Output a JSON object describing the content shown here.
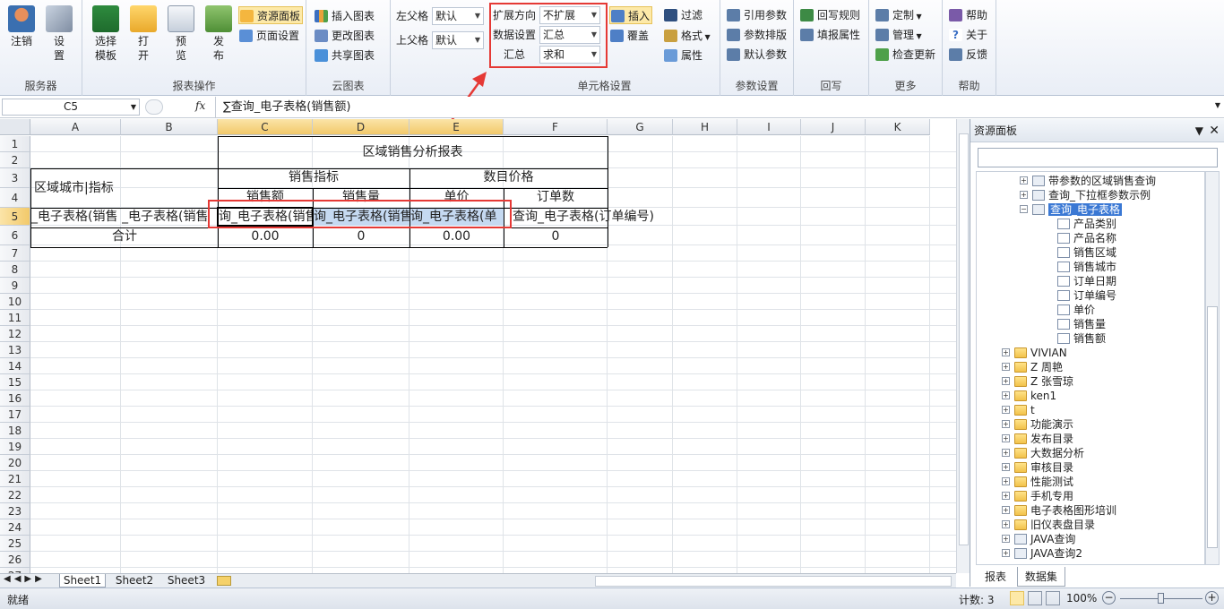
{
  "ribbon": {
    "groups": {
      "server": {
        "label": "服务器",
        "logout": "注销",
        "settings": "设置"
      },
      "report": {
        "label": "报表操作",
        "select_template": "选择模板",
        "open": "打开",
        "preview": "预览",
        "publish": "发布"
      },
      "panel_btns": {
        "resource_panel": "资源面板",
        "page_setup": "页面设置"
      },
      "cloud": {
        "label": "云图表",
        "insert_chart": "插入图表",
        "change_chart": "更改图表",
        "share_chart": "共享图表"
      },
      "parent": {
        "left_parent": "左父格",
        "left_value": "默认",
        "top_parent": "上父格",
        "top_value": "默认"
      },
      "cellset": {
        "label": "单元格设置",
        "expand_dir": "扩展方向",
        "expand_value": "不扩展",
        "data_setting": "数据设置",
        "data_value": "汇总",
        "summary": "汇总",
        "summary_value": "求和"
      },
      "insert": {
        "insert": "插入",
        "cover": "覆盖",
        "filter": "过滤",
        "format": "格式",
        "property": "属性"
      },
      "params": {
        "label": "参数设置",
        "ref_params": "引用参数",
        "param_layout": "参数排版",
        "default_params": "默认参数"
      },
      "writeback": {
        "label": "回写",
        "rules": "回写规则",
        "fill_props": "填报属性"
      },
      "more": {
        "label": "更多",
        "custom": "定制",
        "manage": "管理",
        "check_update": "检查更新"
      },
      "help": {
        "label": "帮助",
        "help": "帮助",
        "about": "关于",
        "feedback": "反馈"
      }
    }
  },
  "formula_bar": {
    "name_box": "C5",
    "fx": "fx",
    "formula": "∑查询_电子表格(销售额)"
  },
  "sheet": {
    "columns": [
      "A",
      "B",
      "C",
      "D",
      "E",
      "F",
      "G",
      "H",
      "I",
      "J",
      "K"
    ],
    "rows": [
      "1",
      "2",
      "3",
      "4",
      "5",
      "6",
      "7",
      "8",
      "9",
      "10",
      "11",
      "12",
      "13",
      "14",
      "15",
      "16",
      "17",
      "18",
      "19",
      "20",
      "21",
      "22",
      "23",
      "24",
      "25",
      "26",
      "27"
    ],
    "title": "区域销售分析报表",
    "city_header": "区域城市|指标",
    "sales_indicator": "销售指标",
    "count_price": "数目价格",
    "sub_headers": [
      "销售额",
      "销售量",
      "单价",
      "订单数"
    ],
    "row5": [
      "_电子表格(销售",
      "_电子表格(销售",
      "询_电子表格(销售",
      "询_电子表格(销售",
      "询_电子表格(单",
      "查询_电子表格(订单编号)"
    ],
    "total_label": "合计",
    "totals": [
      "0.00",
      "0",
      "0.00",
      "0"
    ]
  },
  "sheet_tabs": [
    "Sheet1",
    "Sheet2",
    "Sheet3"
  ],
  "resource_panel": {
    "title": "资源面板",
    "search_placeholder": "",
    "tree": {
      "queries": [
        "带参数的区域销售查询",
        "查询_下拉框参数示例",
        "查询_电子表格"
      ],
      "fields": [
        "产品类别",
        "产品名称",
        "销售区域",
        "销售城市",
        "订单日期",
        "订单编号",
        "单价",
        "销售量",
        "销售额"
      ],
      "folders": [
        "VIVIAN",
        "Z 周艳",
        "Z 张雪琼",
        "ken1",
        "t",
        "功能演示",
        "发布目录",
        "大数据分析",
        "审核目录",
        "性能测试",
        "手机专用",
        "电子表格图形培训",
        "旧仪表盘目录"
      ],
      "java": [
        "JAVA查询",
        "JAVA查询2"
      ]
    },
    "tabs": [
      "报表",
      "数据集"
    ]
  },
  "status": {
    "ready": "就绪",
    "count": "计数: 3",
    "zoom": "100%"
  },
  "colors": {
    "accent_red": "#e53935",
    "selection": "#c5d9f1",
    "highlight": "#fde9a8"
  }
}
